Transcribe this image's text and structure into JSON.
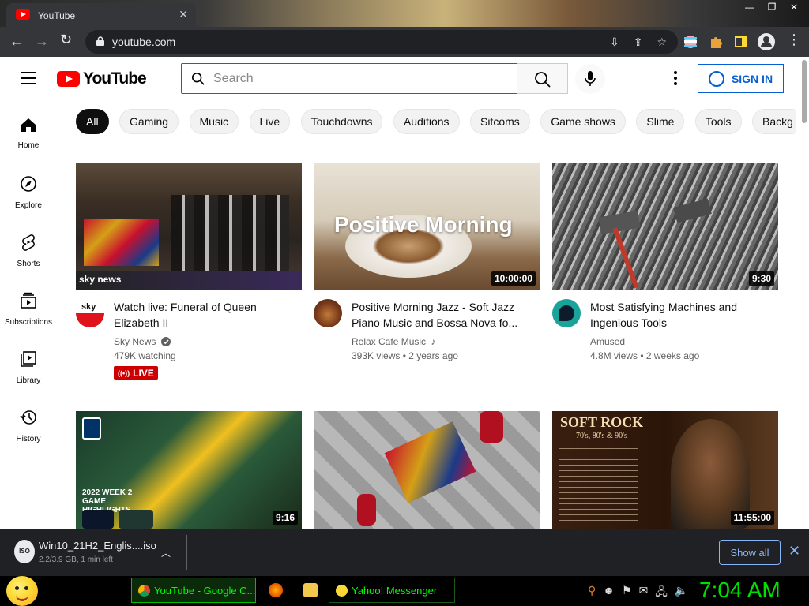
{
  "browser": {
    "tab_title": "YouTube",
    "url": "youtube.com"
  },
  "header": {
    "logo_text": "YouTube",
    "search_placeholder": "Search",
    "signin_label": "SIGN IN"
  },
  "chips": [
    "All",
    "Gaming",
    "Music",
    "Live",
    "Touchdowns",
    "Auditions",
    "Sitcoms",
    "Game shows",
    "Slime",
    "Tools",
    "Backg"
  ],
  "rail": [
    {
      "label": "Home",
      "icon": "home-icon"
    },
    {
      "label": "Explore",
      "icon": "compass-icon"
    },
    {
      "label": "Shorts",
      "icon": "shorts-icon"
    },
    {
      "label": "Subscriptions",
      "icon": "subscriptions-icon"
    },
    {
      "label": "Library",
      "icon": "library-icon"
    },
    {
      "label": "History",
      "icon": "history-icon"
    }
  ],
  "videos": [
    {
      "title": "Watch live: Funeral of Queen Elizabeth II",
      "channel": "Sky News",
      "meta": "479K watching",
      "live_label": "LIVE",
      "duration": "",
      "thumb_overlay": "sky news"
    },
    {
      "title": "Positive Morning Jazz - Soft Jazz Piano Music and Bossa Nova fo...",
      "channel": "Relax Cafe Music",
      "meta": "393K views • 2 years ago",
      "duration": "10:00:00",
      "thumb_overlay": "Positive Morning"
    },
    {
      "title": "Most Satisfying Machines and Ingenious Tools",
      "channel": "Amused",
      "meta": "4.8M views • 2 weeks ago",
      "duration": "9:30",
      "thumb_overlay": ""
    },
    {
      "title": "",
      "channel": "",
      "meta": "",
      "duration": "9:16",
      "thumb_overlay": "2022 WEEK 2 GAME HIGHLIGHTS"
    },
    {
      "title": "",
      "channel": "",
      "meta": "",
      "duration": "",
      "thumb_overlay": ""
    },
    {
      "title": "",
      "channel": "",
      "meta": "",
      "duration": "11:55:00",
      "thumb_overlay": "SOFT ROCK",
      "thumb_sub": "70's, 80's & 90's"
    }
  ],
  "download": {
    "icon_text": "ISO",
    "filename": "Win10_21H2_Englis....iso",
    "status": "2.2/3.9 GB, 1 min left",
    "show_all": "Show all"
  },
  "taskbar": {
    "tasks": [
      "YouTube - Google C...",
      "Yahoo! Messenger"
    ],
    "clock": "7:04 AM"
  },
  "colors": {
    "brand_red": "#ff0000",
    "link_blue": "#065fd4",
    "clock_green": "#00e000"
  }
}
